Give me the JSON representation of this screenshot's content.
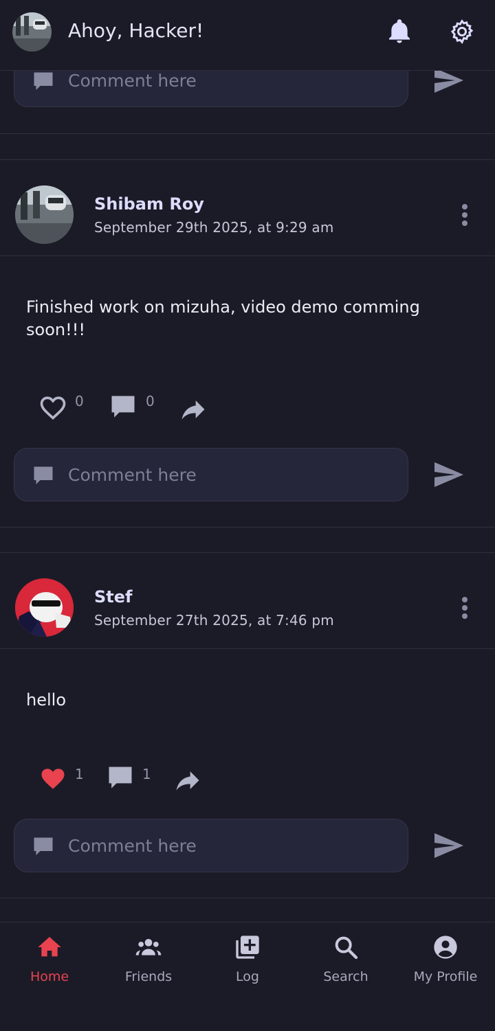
{
  "header": {
    "greeting": "Ahoy, Hacker!",
    "notification_icon": "bell-icon",
    "settings_icon": "gear-icon"
  },
  "comment_placeholder": "Comment here",
  "posts": [
    {
      "author": "Shibam Roy",
      "date": "September 29th 2025, at 9:29 am",
      "text": "Finished work on mizuha, video demo comming soon!!!",
      "likes": "0",
      "comments": "0",
      "liked": false
    },
    {
      "author": "Stef",
      "date": "September 27th 2025, at 7:46 pm",
      "text": "hello",
      "likes": "1",
      "comments": "1",
      "liked": true
    }
  ],
  "nav": {
    "items": [
      {
        "label": "Home",
        "icon": "home-icon",
        "active": true
      },
      {
        "label": "Friends",
        "icon": "friends-icon"
      },
      {
        "label": "Log",
        "icon": "add-post-icon"
      },
      {
        "label": "Search",
        "icon": "search-icon"
      },
      {
        "label": "My Profile",
        "icon": "profile-icon"
      }
    ]
  },
  "colors": {
    "background": "#1b1b27",
    "accent": "#e8434f",
    "text": "#e4e4f4",
    "muted": "#9597ab"
  }
}
